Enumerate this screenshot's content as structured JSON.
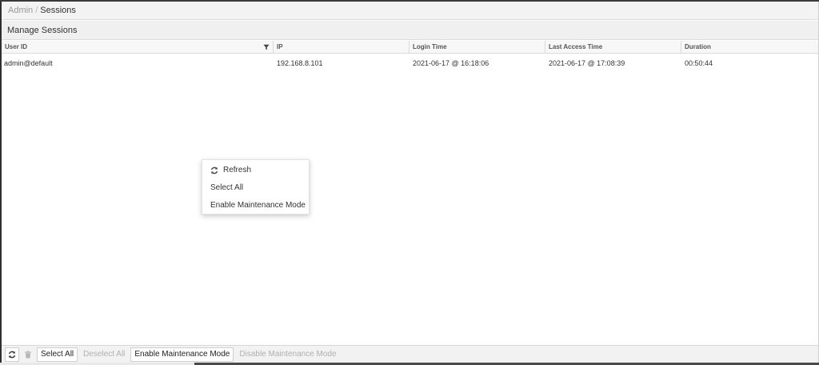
{
  "breadcrumb": {
    "parent": "Admin",
    "separator": "/",
    "current": "Sessions"
  },
  "section": {
    "title": "Manage Sessions"
  },
  "table": {
    "columns": [
      "User ID",
      "IP",
      "Login Time",
      "Last Access Time",
      "Duration"
    ],
    "rows": [
      {
        "user_id": "admin@default",
        "ip": "192.168.8.101",
        "login_time": "2021-06-17 @ 16:18:06",
        "last_access_time": "2021-06-17 @ 17:08:39",
        "duration": "00:50:44"
      }
    ]
  },
  "context_menu": {
    "items": [
      {
        "label": "Refresh",
        "icon": "refresh-icon"
      },
      {
        "label": "Select All"
      },
      {
        "label": "Enable Maintenance Mode"
      }
    ]
  },
  "toolbar": {
    "refresh_icon": "refresh-icon",
    "delete_icon": "trash-icon",
    "select_all": "Select All",
    "deselect_all": "Deselect All",
    "enable_maintenance": "Enable Maintenance Mode",
    "disable_maintenance": "Disable Maintenance Mode"
  },
  "colors": {
    "disabled_text": "#b0b0b0",
    "header_bg": "#f0f0f0",
    "border": "#dcdcdc"
  }
}
